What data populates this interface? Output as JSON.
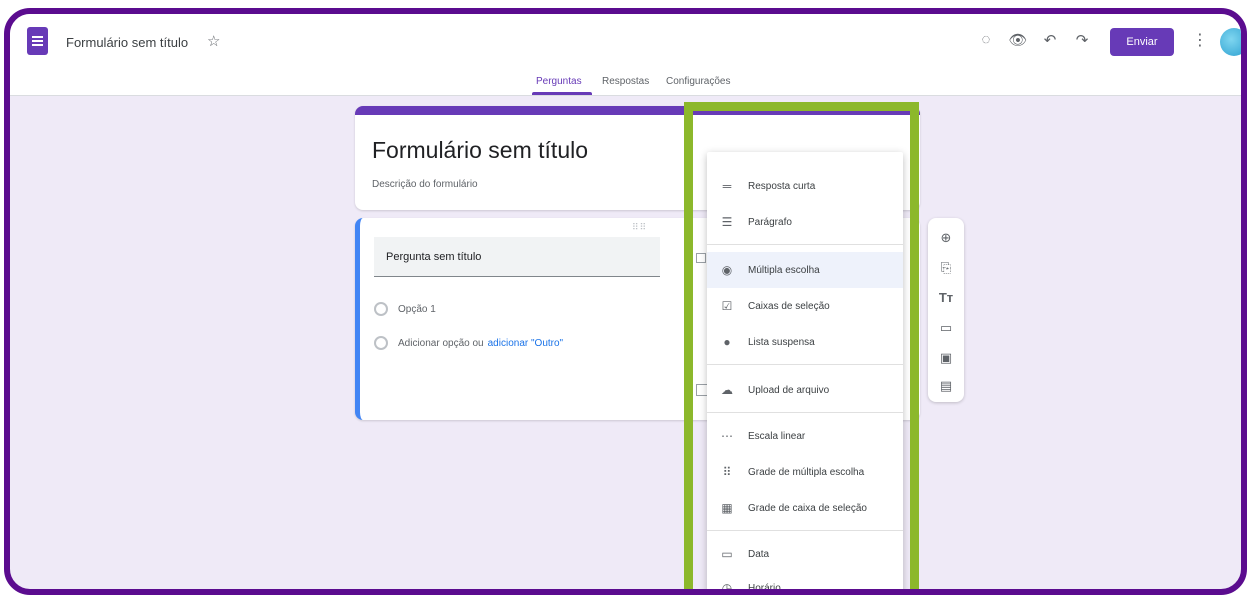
{
  "header": {
    "title": "Formulário sem título",
    "star_icon": "star-outline-icon",
    "icons": [
      "palette-icon",
      "preview-eye-icon",
      "undo-icon",
      "redo-icon"
    ],
    "send_label": "Enviar",
    "more_icon": "more-vert-icon"
  },
  "tabs": [
    {
      "label": "Perguntas",
      "active": true
    },
    {
      "label": "Respostas",
      "active": false
    },
    {
      "label": "Configurações",
      "active": false
    }
  ],
  "title_card": {
    "title": "Formulário sem título",
    "description": "Descrição do formulário"
  },
  "question_card": {
    "question": "Pergunta sem título",
    "option1": "Opção 1",
    "add_option": "Adicionar opção ou",
    "add_other": "adicionar \"Outro\""
  },
  "menu": {
    "items": [
      {
        "label": "Resposta curta",
        "icon": "short-text-icon"
      },
      {
        "label": "Parágrafo",
        "icon": "paragraph-icon"
      },
      {
        "label": "Múltipla escolha",
        "icon": "radio-button-icon",
        "selected": true
      },
      {
        "label": "Caixas de seleção",
        "icon": "checkbox-icon"
      },
      {
        "label": "Lista suspensa",
        "icon": "dropdown-icon"
      },
      {
        "label": "Upload de arquivo",
        "icon": "cloud-upload-icon"
      },
      {
        "label": "Escala linear",
        "icon": "linear-scale-icon"
      },
      {
        "label": "Grade de múltipla escolha",
        "icon": "grid-icon"
      },
      {
        "label": "Grade de caixa de seleção",
        "icon": "checkbox-grid-icon"
      },
      {
        "label": "Data",
        "icon": "calendar-icon"
      },
      {
        "label": "Horário",
        "icon": "clock-icon"
      }
    ]
  },
  "side_toolbar": [
    "add-question-icon",
    "import-questions-icon",
    "add-title-icon",
    "add-image-icon",
    "add-video-icon",
    "add-section-icon"
  ],
  "colors": {
    "frame": "#5b0c8f",
    "brand": "#673ab7",
    "highlight": "#8cb82b",
    "background": "#efeaf7"
  }
}
